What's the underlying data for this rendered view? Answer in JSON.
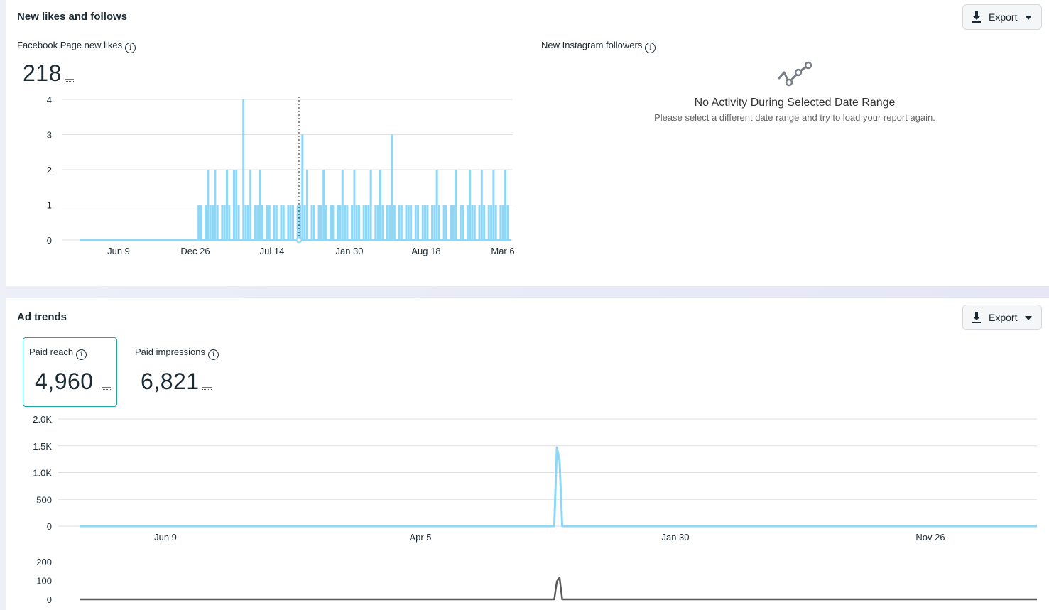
{
  "likes_section": {
    "title": "New likes and follows",
    "export_label": "Export",
    "fb": {
      "label": "Facebook Page new likes",
      "info": "i",
      "total": "218"
    },
    "ig": {
      "label": "New Instagram followers",
      "info": "i",
      "empty_title": "No Activity During Selected Date Range",
      "empty_sub": "Please select a different date range and try to load your report again."
    }
  },
  "ads_section": {
    "title": "Ad trends",
    "export_label": "Export",
    "paid_reach": {
      "label": "Paid reach",
      "info": "i",
      "value": "4,960"
    },
    "paid_impressions": {
      "label": "Paid impressions",
      "info": "i",
      "value": "6,821"
    }
  },
  "colors": {
    "accent": "#21a6a8",
    "series_light_blue": "#8dd8f8",
    "series_dark": "#5a5a5a",
    "grid": "#dddfe2"
  },
  "chart_data": [
    {
      "type": "bar",
      "name": "facebook-new-likes",
      "x_tick_labels": [
        "Jun 9",
        "Dec 26",
        "Jul 14",
        "Jan 30",
        "Aug 18",
        "Mar 6"
      ],
      "y_tick_labels": [
        "0",
        "1",
        "2",
        "3",
        "4"
      ],
      "ylim": [
        0,
        4
      ],
      "grid": true,
      "note_marker_index": 93,
      "values": [
        0,
        0,
        0,
        0,
        0,
        0,
        0,
        0,
        0,
        0,
        0,
        0,
        0,
        0,
        0,
        0,
        0,
        0,
        0,
        0,
        0,
        0,
        0,
        0,
        0,
        0,
        0,
        0,
        0,
        0,
        0,
        0,
        0,
        0,
        0,
        0,
        0,
        0,
        0,
        0,
        0,
        0,
        0,
        0,
        0,
        0,
        0,
        0,
        0,
        0,
        1,
        1,
        0,
        1,
        2,
        1,
        1,
        2,
        1,
        0,
        1,
        1,
        2,
        1,
        0,
        2,
        2,
        1,
        0,
        4,
        1,
        1,
        2,
        0,
        1,
        1,
        2,
        1,
        0,
        1,
        1,
        0,
        1,
        1,
        0,
        1,
        1,
        0,
        1,
        1,
        1,
        0,
        1,
        1,
        3,
        1,
        2,
        0,
        1,
        1,
        0,
        1,
        1,
        2,
        1,
        0,
        1,
        1,
        0,
        1,
        1,
        2,
        1,
        1,
        0,
        1,
        2,
        1,
        1,
        0,
        1,
        1,
        1,
        2,
        0,
        1,
        1,
        2,
        1,
        0,
        1,
        1,
        3,
        1,
        0,
        1,
        1,
        0,
        1,
        1,
        1,
        0,
        1,
        1,
        0,
        1,
        1,
        1,
        0,
        1,
        1,
        2,
        1,
        0,
        1,
        1,
        0,
        1,
        1,
        2,
        0,
        1,
        1,
        0,
        1,
        2,
        1,
        1,
        0,
        1,
        2,
        1,
        0,
        1,
        1,
        2,
        1,
        0,
        1,
        1,
        2,
        1,
        0
      ]
    },
    {
      "type": "line",
      "name": "paid-reach",
      "x_tick_labels": [
        "Jun 9",
        "Apr 5",
        "Jan 30",
        "Nov 26"
      ],
      "y_tick_labels": [
        "0",
        "500",
        "1.0K",
        "1.5K",
        "2.0K"
      ],
      "ylim": [
        0,
        2000
      ],
      "grid": true,
      "peak_index": 180,
      "values_sparse": {
        "178": 0,
        "179": 1470,
        "180": 1220,
        "181": 0
      },
      "length": 360
    },
    {
      "type": "line",
      "name": "paid-impressions-mini",
      "y_tick_labels": [
        "0",
        "100",
        "200"
      ],
      "ylim": [
        0,
        200
      ],
      "values_sparse": {
        "178": 0,
        "179": 95,
        "180": 115,
        "181": 0
      },
      "length": 360
    }
  ]
}
